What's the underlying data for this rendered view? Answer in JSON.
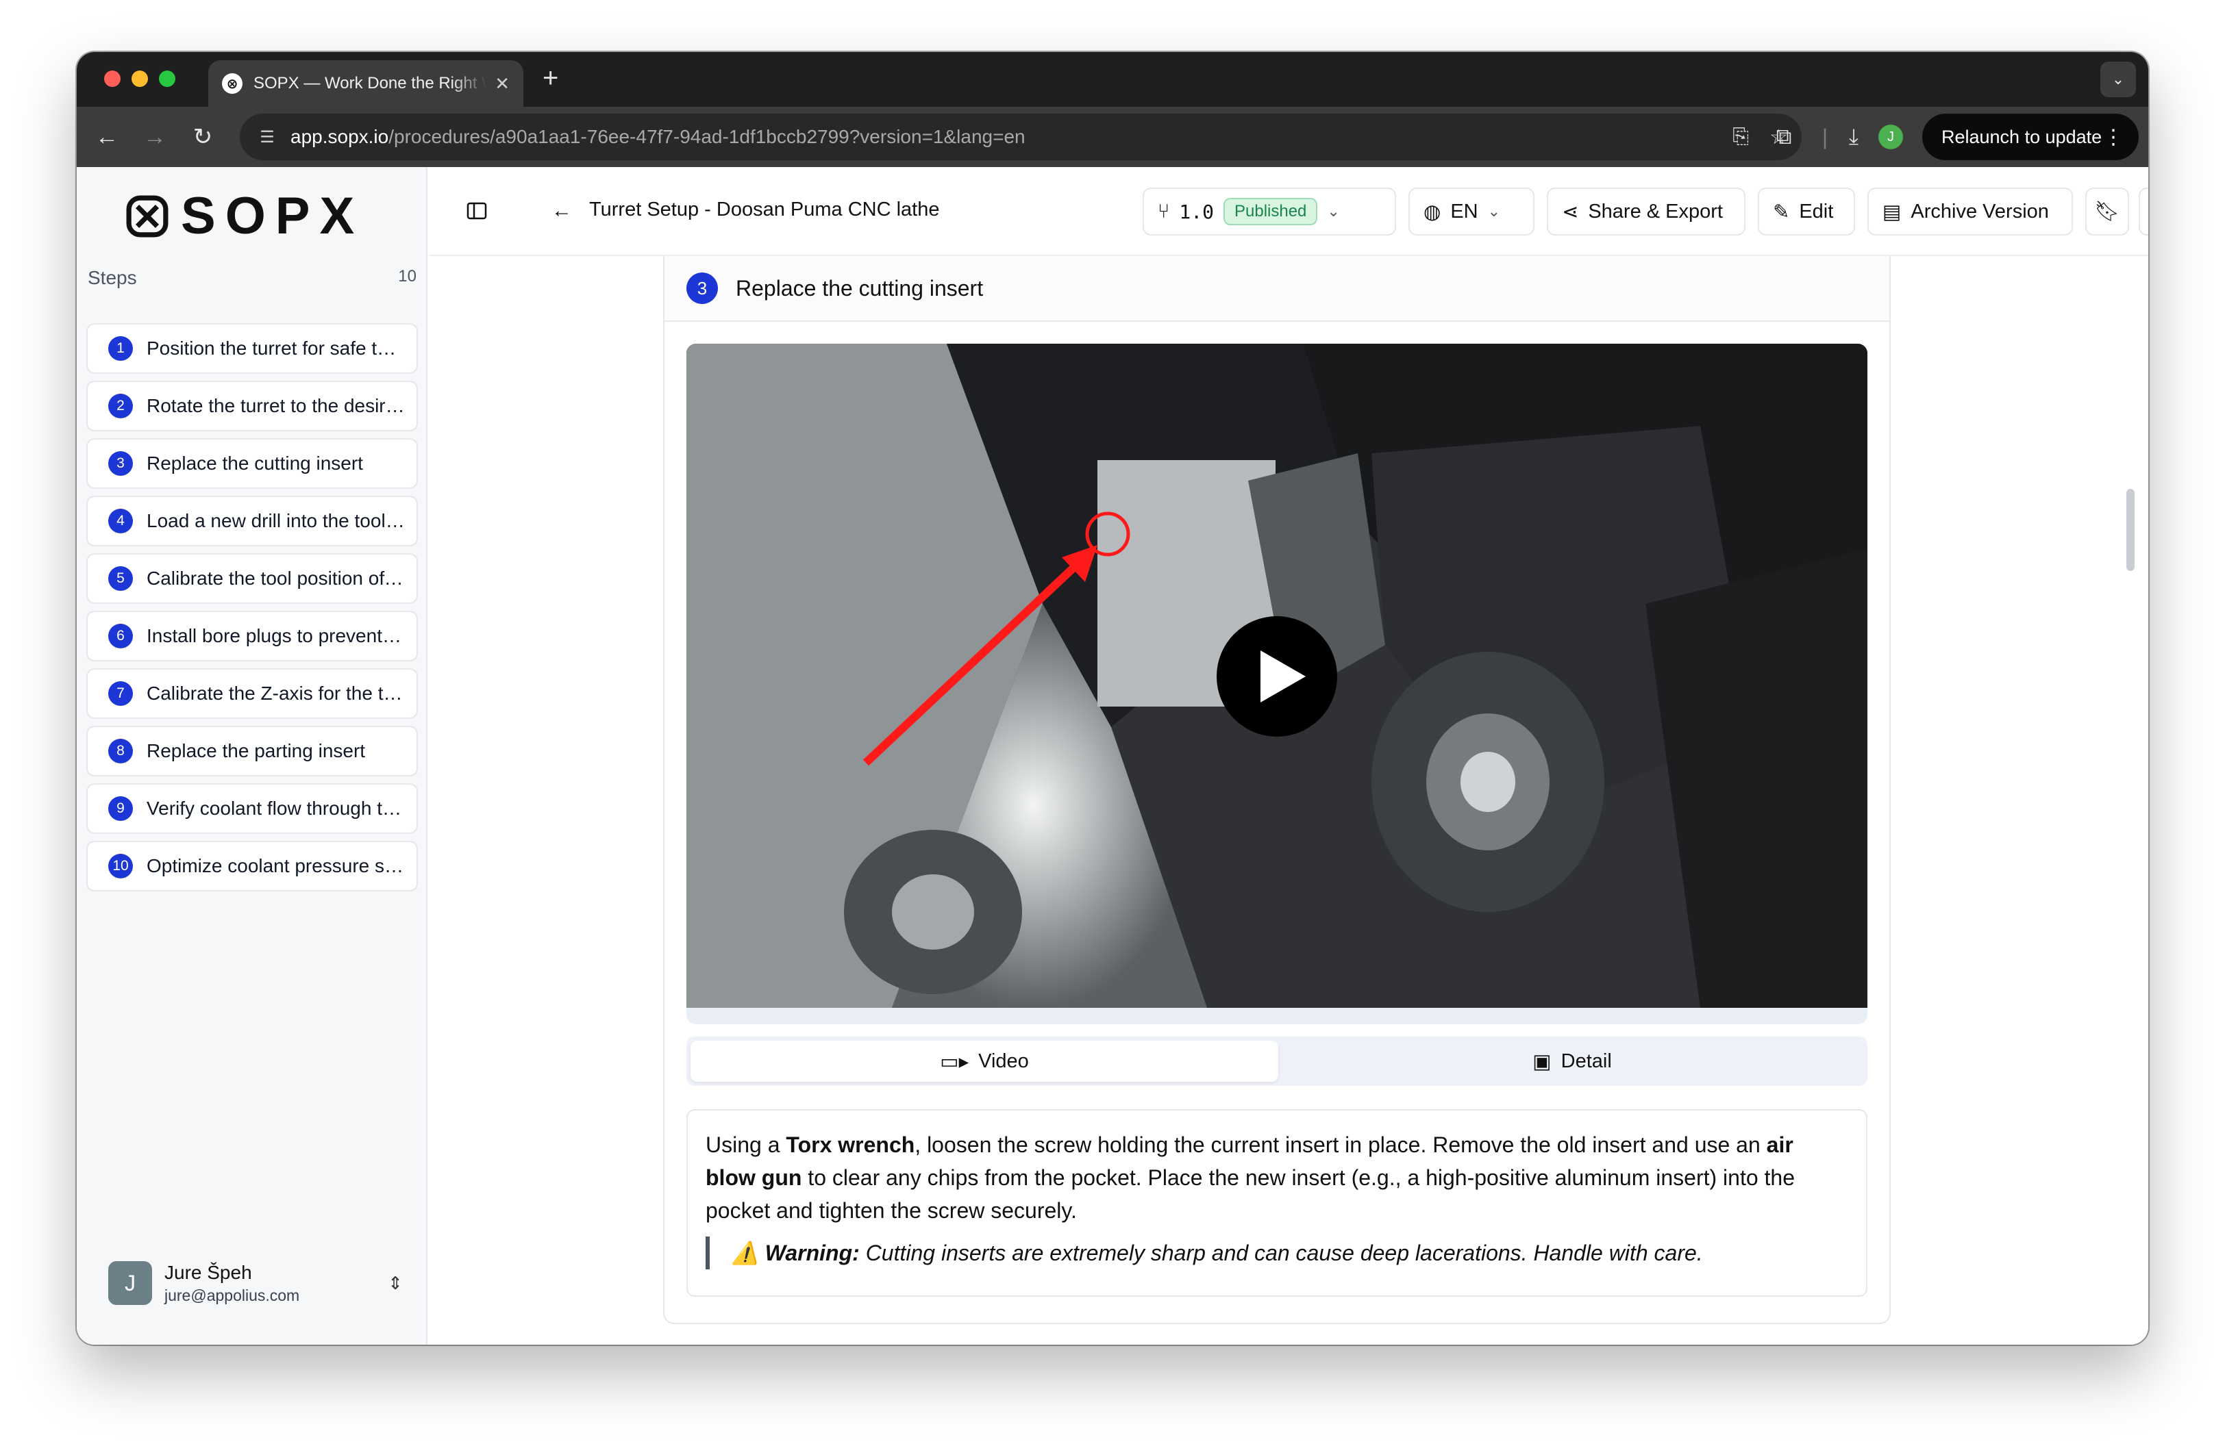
{
  "browser": {
    "tab_title": "SOPX — Work Done the Right Way",
    "url_host": "app.sopx.io",
    "url_path": "/procedures/a90a1aa1-76ee-47f7-94ad-1df1bccb2799?version=1&lang=en",
    "profile_initial": "J",
    "relaunch_label": "Relaunch to update"
  },
  "sidebar": {
    "logo_text": "SOPX",
    "steps_label": "Steps",
    "steps_count": "10",
    "steps": [
      {
        "num": "1",
        "label": "Position the turret for safe tool access"
      },
      {
        "num": "2",
        "label": "Rotate the turret to the desired station"
      },
      {
        "num": "3",
        "label": "Replace the cutting insert"
      },
      {
        "num": "4",
        "label": "Load a new drill into the tool holder"
      },
      {
        "num": "5",
        "label": "Calibrate the tool position offset"
      },
      {
        "num": "6",
        "label": "Install bore plugs to prevent coolant leaks"
      },
      {
        "num": "7",
        "label": "Calibrate the Z-axis for the tool"
      },
      {
        "num": "8",
        "label": "Replace the parting insert"
      },
      {
        "num": "9",
        "label": "Verify coolant flow through the tool"
      },
      {
        "num": "10",
        "label": "Optimize coolant pressure settings"
      }
    ],
    "user": {
      "initial": "J",
      "name": "Jure Špeh",
      "email": "jure@appolius.com"
    }
  },
  "header": {
    "title": "Turret Setup - Doosan Puma CNC lathe",
    "version": "1.0",
    "status": "Published",
    "language": "EN",
    "share_label": "Share & Export",
    "edit_label": "Edit",
    "archive_label": "Archive Version"
  },
  "step": {
    "number": "3",
    "title": "Replace the cutting insert",
    "tab_video": "Video",
    "tab_detail": "Detail",
    "desc_p1": "Using a ",
    "desc_b1": "Torx wrench",
    "desc_p2": ", loosen the screw holding the current insert in place. Remove the old insert and use an ",
    "desc_b2": "air blow gun",
    "desc_p3": " to clear any chips from the pocket. Place the new insert (e.g., a high-positive aluminum insert) into the pocket and tighten the screw securely.",
    "warning_icon": "⚠️",
    "warning_label": "Warning:",
    "warning_text": " Cutting inserts are extremely sharp and can cause deep lacerations. Handle with care."
  }
}
